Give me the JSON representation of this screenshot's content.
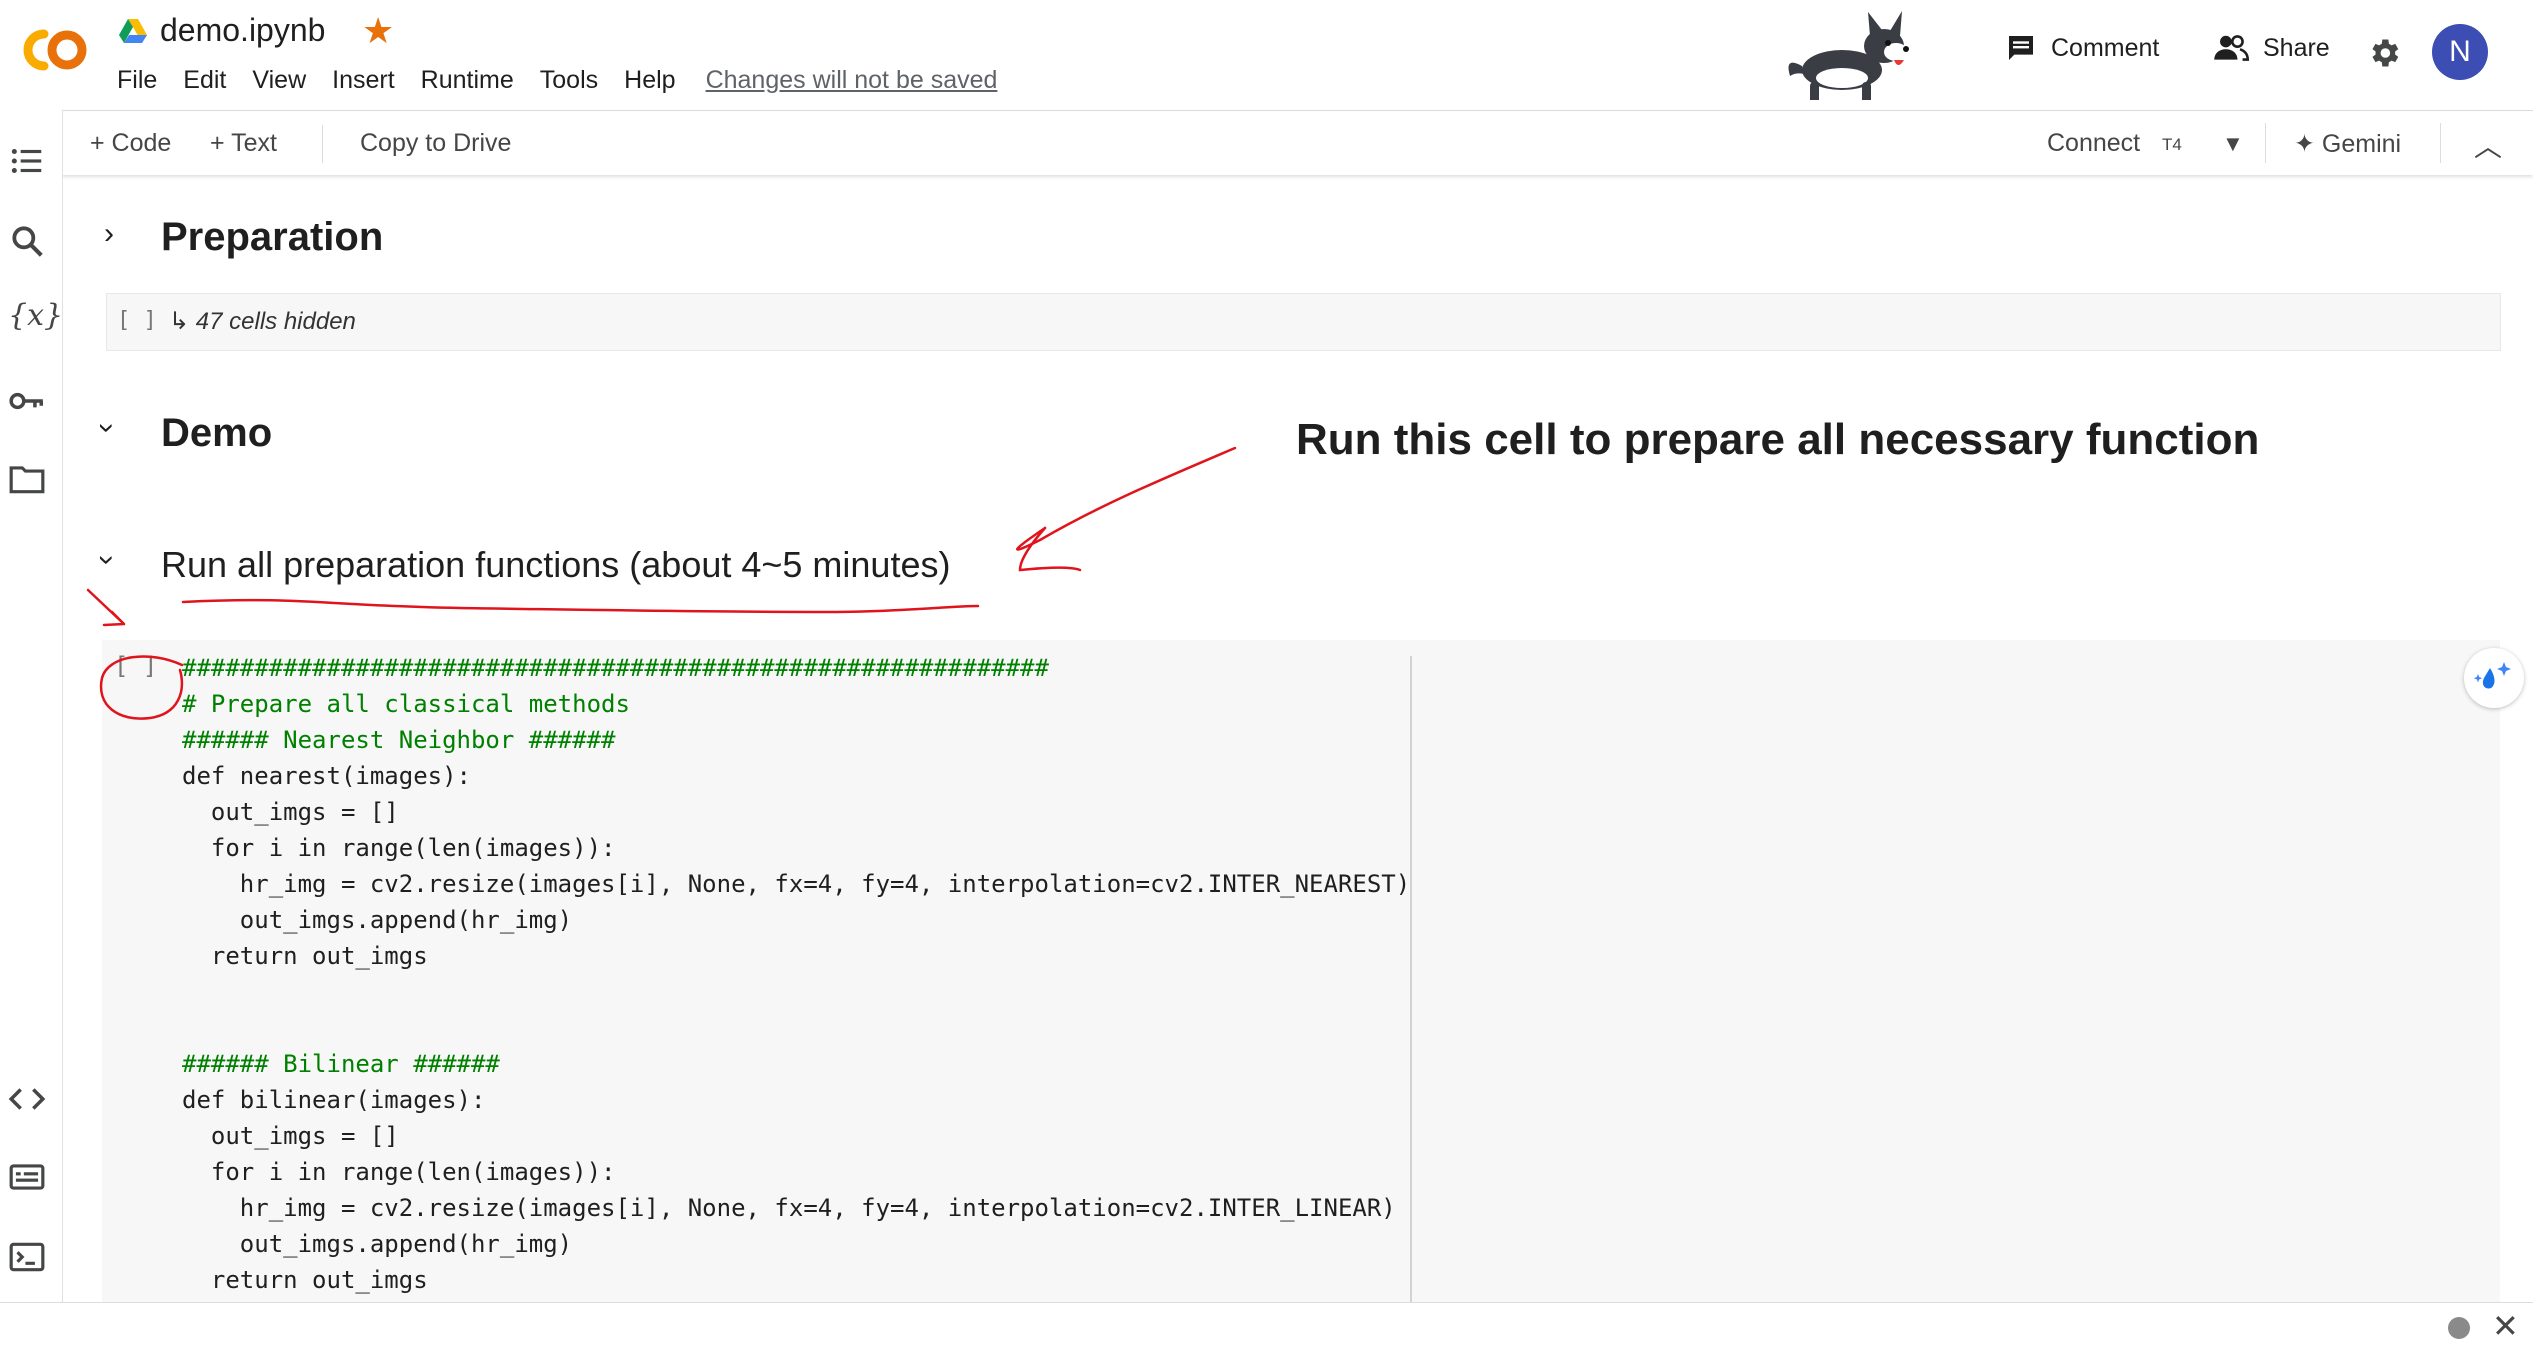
{
  "header": {
    "title": "demo.ipynb",
    "menu": [
      "File",
      "Edit",
      "View",
      "Insert",
      "Runtime",
      "Tools",
      "Help"
    ],
    "unsaved_notice": "Changes will not be saved",
    "comment_label": "Comment",
    "share_label": "Share",
    "avatar_letter": "N",
    "logo_text": "CO",
    "star_color": "#e8710a",
    "avatar_color": "#3c4eb3"
  },
  "toolbar": {
    "code_label": "+ Code",
    "text_label": "+ Text",
    "copy_label": "Copy to Drive",
    "connect_label": "Connect",
    "runtime_type": "T4",
    "gemini_label": "Gemini"
  },
  "rail": {
    "icons": [
      "table-of-contents-icon",
      "search-icon",
      "variables-icon",
      "secrets-key-icon",
      "files-folder-icon",
      "code-snippets-icon",
      "command-palette-icon",
      "terminal-icon"
    ],
    "variables_glyph": "{x}"
  },
  "notebook": {
    "section_preparation": "Preparation",
    "hidden_cells": "47 cells hidden",
    "section_demo": "Demo",
    "annotation": "Run this cell to prepare all necessary function",
    "section_run": "Run all preparation functions (about 4~5 minutes)",
    "run_bracket": "[ ]",
    "hidden_bracket": "[ ]"
  },
  "code_lines": [
    "############################################################",
    "# Prepare all classical methods",
    "###### Nearest Neighbor ######",
    "def nearest(images):",
    "  out_imgs = []",
    "  for i in range(len(images)):",
    "    hr_img = cv2.resize(images[i], None, fx=4, fy=4, interpolation=cv2.INTER_NEAREST)",
    "    out_imgs.append(hr_img)",
    "  return out_imgs",
    "",
    "",
    "###### Bilinear ######",
    "def bilinear(images):",
    "  out_imgs = []",
    "  for i in range(len(images)):",
    "    hr_img = cv2.resize(images[i], None, fx=4, fy=4, interpolation=cv2.INTER_LINEAR)",
    "    out_imgs.append(hr_img)",
    "  return out_imgs"
  ],
  "annotation_color": "#e0141c"
}
